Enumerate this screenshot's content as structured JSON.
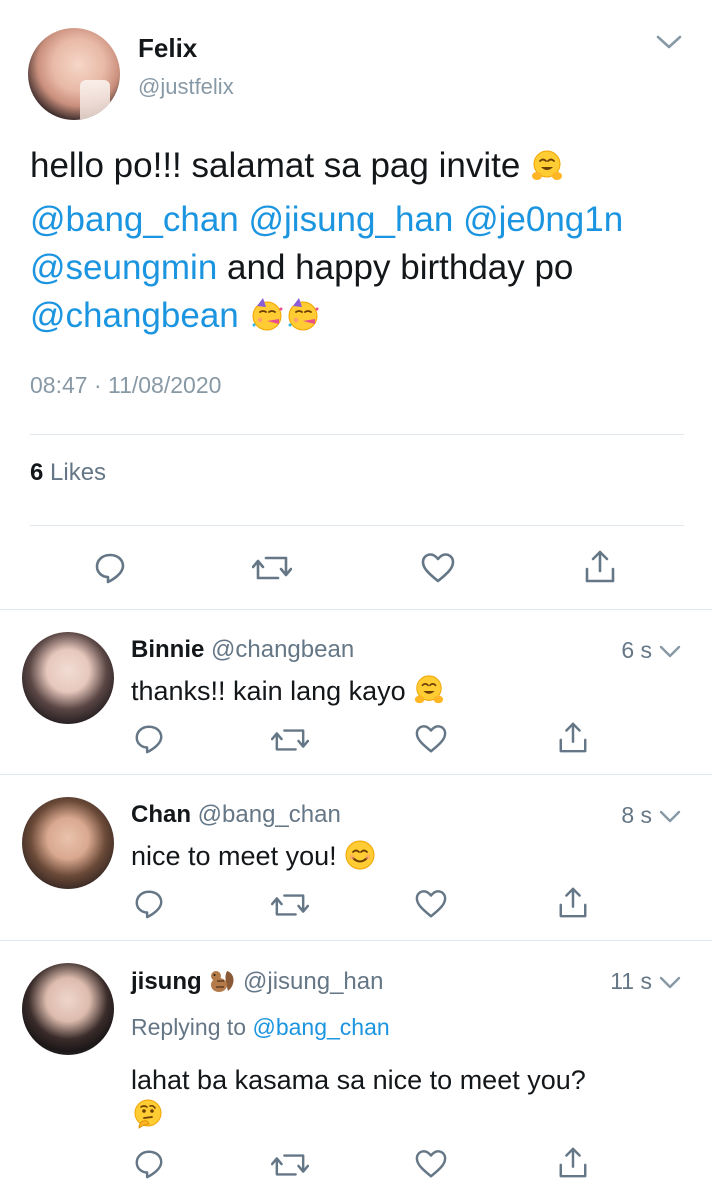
{
  "main_tweet": {
    "name": "Felix",
    "handle": "@justfelix",
    "text_part1": "hello po!!! salamat sa pag invite ",
    "mention1": "@bang_chan",
    "mention2": "@jisung_han",
    "mention3": "@je0ng1n",
    "mention4": "@seungmin",
    "text_part2": " and happy birthday po",
    "mention5": "@changbean",
    "timestamp": "08:47 · 11/08/2020",
    "likes_count": "6",
    "likes_label": "Likes",
    "emojis": [
      "hugging-face",
      "partying-face",
      "partying-face"
    ]
  },
  "replies": [
    {
      "name": "Binnie",
      "handle": "@changbean",
      "time": "6 s",
      "text": "thanks!! kain lang kayo",
      "emoji": "hugging-face"
    },
    {
      "name": "Chan",
      "handle": "@bang_chan",
      "time": "8 s",
      "text": "nice to meet you!",
      "emoji": "smiling-face"
    },
    {
      "name": "jisung",
      "handle": "@jisung_han",
      "time": "11 s",
      "replying_prefix": "Replying to",
      "replying_to": "@bang_chan",
      "text": "lahat ba kasama sa nice to meet you?",
      "name_emoji": "chipmunk",
      "emoji": "thinking-face"
    }
  ],
  "colors": {
    "accent": "#1b95e0",
    "secondary_text": "#657786",
    "divider": "#e1e8ed",
    "icon": "#657786"
  },
  "icons": [
    "reply-icon",
    "retweet-icon",
    "like-icon",
    "share-icon",
    "chevron-down-icon"
  ]
}
